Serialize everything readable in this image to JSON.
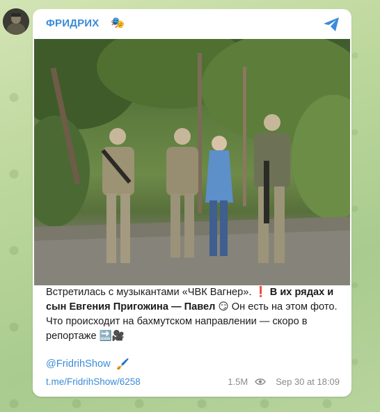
{
  "channel": {
    "name": "ФРИДРИХ",
    "emoji": "🎭"
  },
  "post": {
    "caption_1": "Встретилась с музыкантами «ЧВК Вагнер». ",
    "caption_mark": "❗",
    "caption_bold": " В их рядах и сын Евгения Пригожина — Павел ",
    "caption_emoji1": "😏",
    "caption_2": " Он есть на этом фото. Что происходит на бахмутском направлении — скоро в репортаже ",
    "caption_emoji2": "🔜🎥",
    "mention": "@FridrihShow",
    "mention_emoji": "🖌️",
    "link": "t.me/FridrihShow/6258",
    "views": "1.5M",
    "date": "Sep 30 at 18:09"
  },
  "icons": {
    "share": "share-icon",
    "views": "eye-icon"
  },
  "colors": {
    "accent": "#3a8bd8",
    "background": "#b7d49d"
  }
}
